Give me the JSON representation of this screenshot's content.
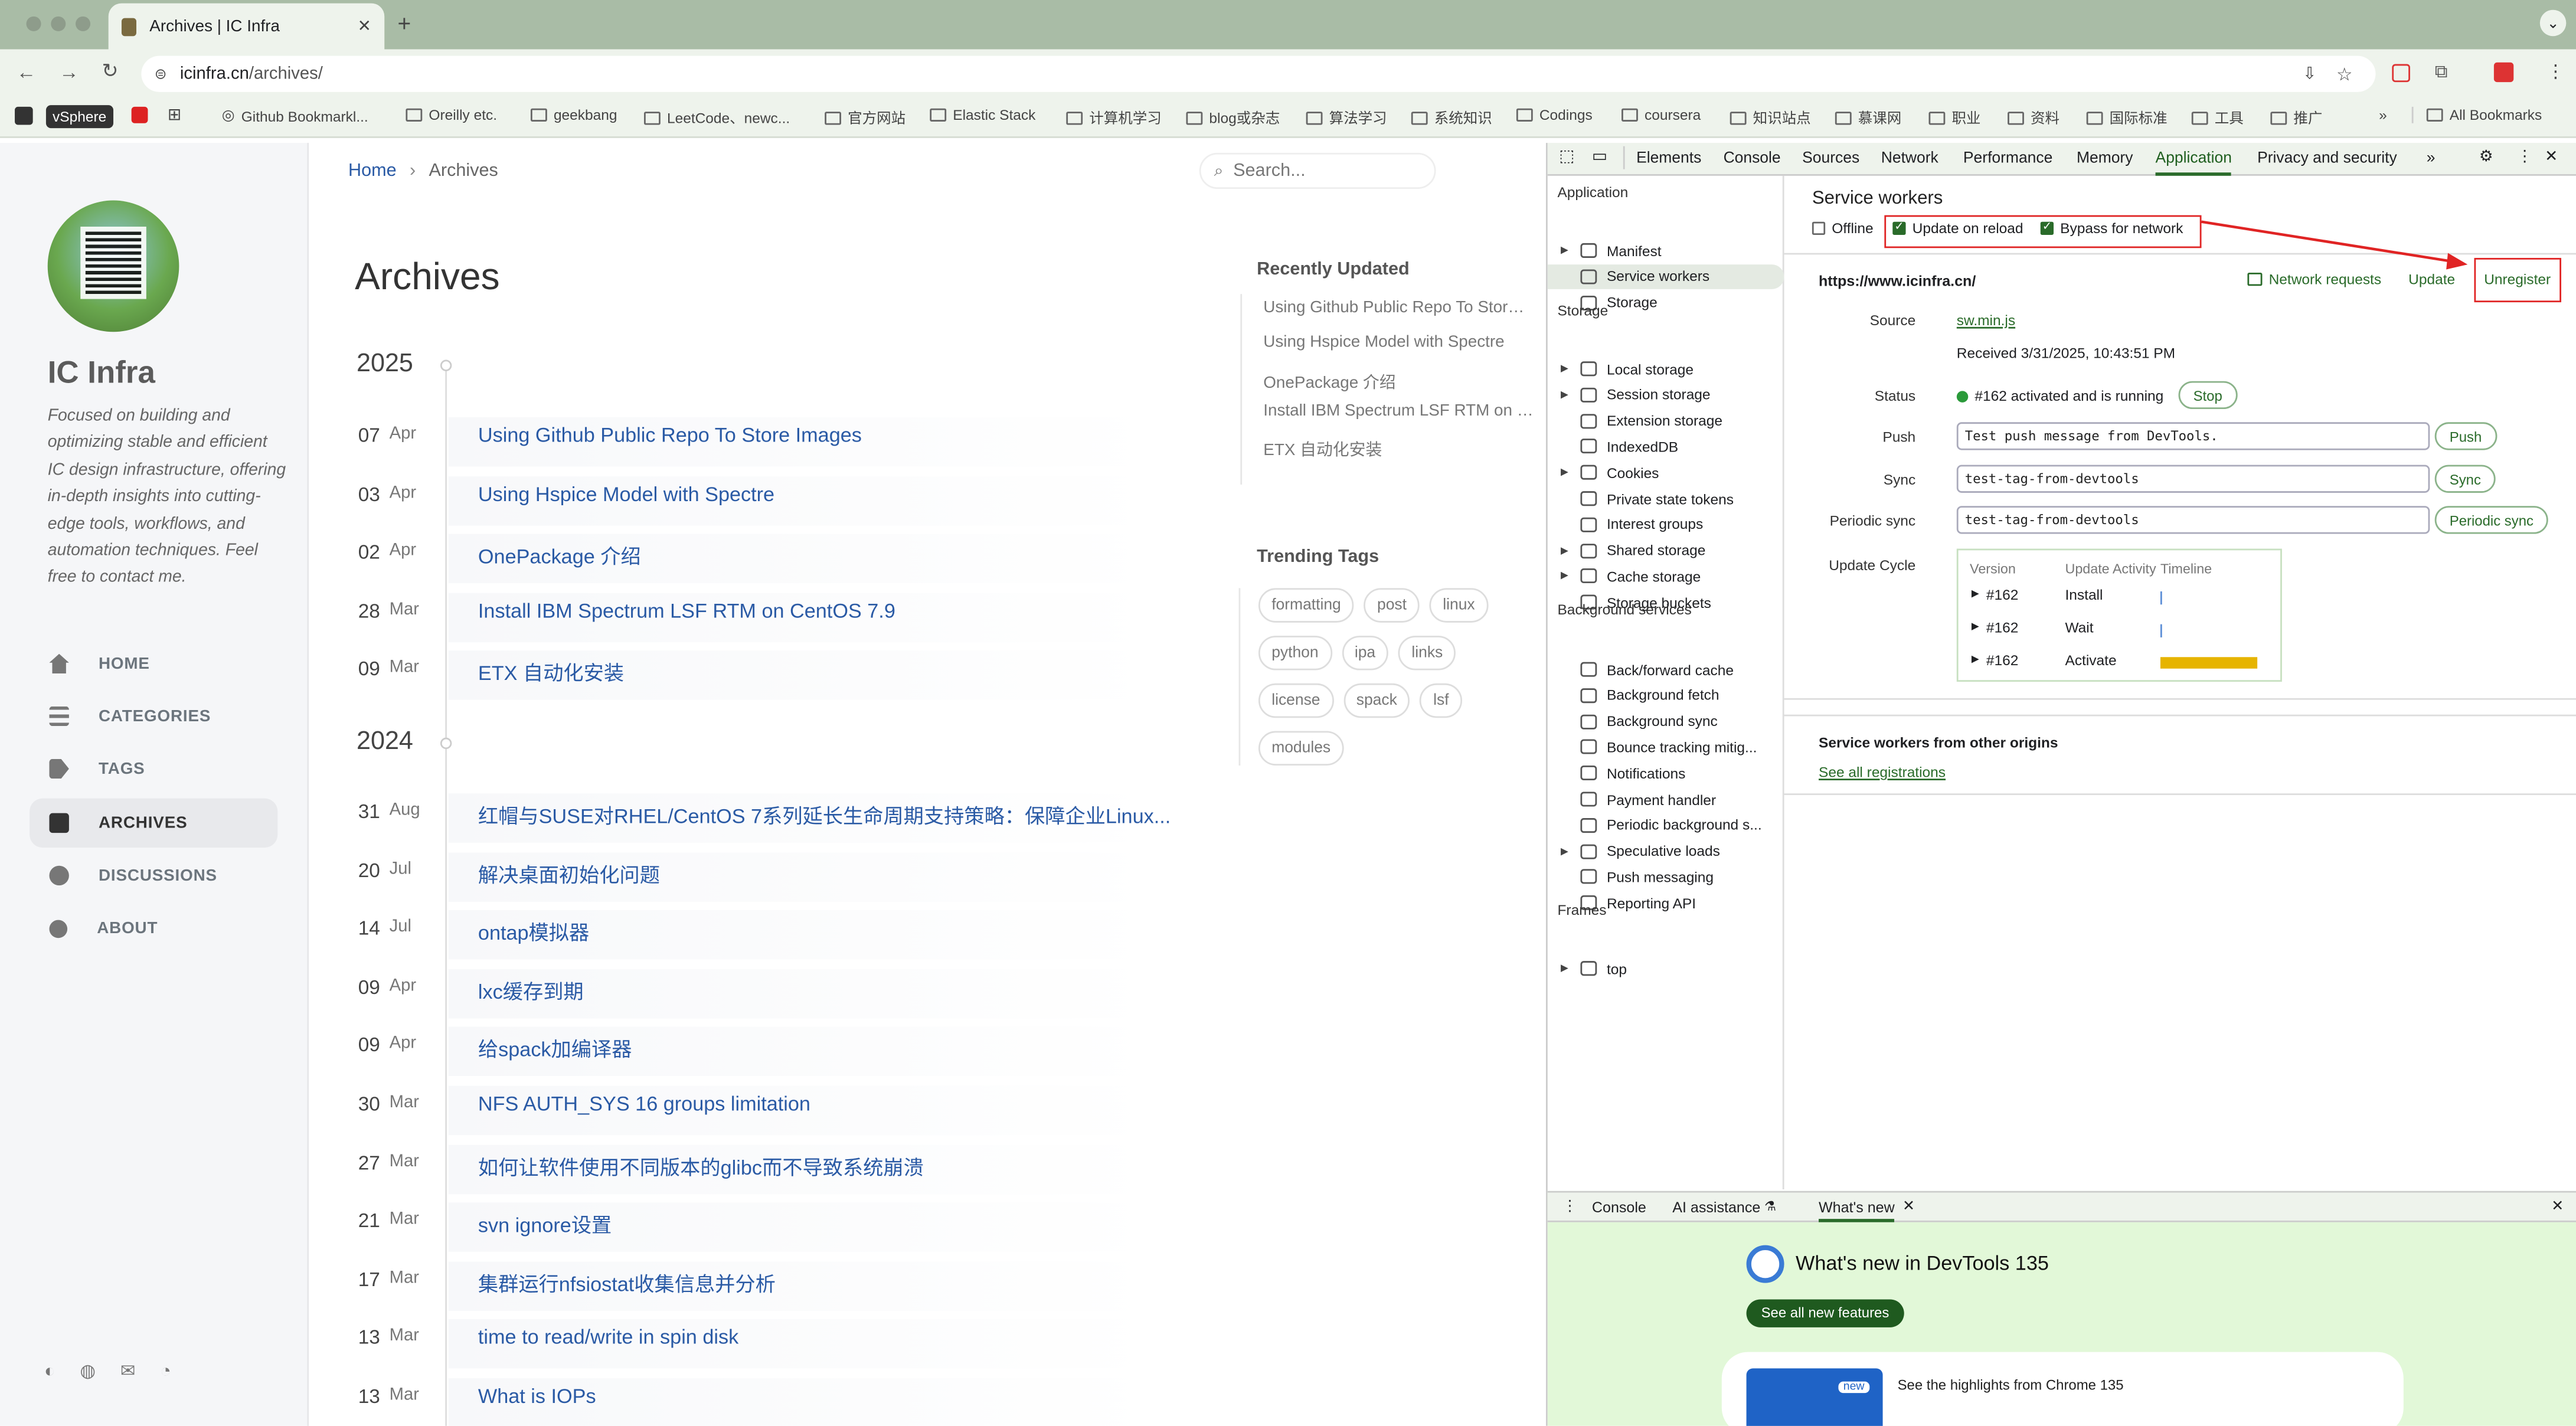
{
  "browser": {
    "tab_title": "Archives | IC Infra",
    "new_tab_symbol": "+",
    "url_host": "icinfra.cn",
    "url_path": "/archives/",
    "bookmarks": [
      "vSphere",
      "Github Bookmarkl...",
      "Oreilly etc.",
      "geekbang",
      "LeetCode、newc...",
      "官方网站",
      "Elastic Stack",
      "计算机学习",
      "blog或杂志",
      "算法学习",
      "系统知识",
      "Codings",
      "coursera",
      "知识站点",
      "慕课网",
      "职业",
      "资料",
      "国际标准",
      "工具",
      "推广"
    ],
    "all_bookmarks": "All Bookmarks"
  },
  "site": {
    "title": "IC Infra",
    "description": "Focused on building and optimizing stable and efficient IC design infrastructure, offering in-depth insights into cutting-edge tools, workflows, and automation techniques. Feel free to contact me.",
    "nav": [
      "HOME",
      "CATEGORIES",
      "TAGS",
      "ARCHIVES",
      "DISCUSSIONS",
      "ABOUT"
    ],
    "active_nav": "ARCHIVES"
  },
  "page": {
    "breadcrumb_home": "Home",
    "breadcrumb_sep": "›",
    "breadcrumb_current": "Archives",
    "search_placeholder": "Search...",
    "heading": "Archives",
    "year_2025": "2025",
    "year_2024": "2024",
    "posts_2025": [
      {
        "day": "07",
        "month": "Apr",
        "title": "Using Github Public Repo To Store Images"
      },
      {
        "day": "03",
        "month": "Apr",
        "title": "Using Hspice Model with Spectre"
      },
      {
        "day": "02",
        "month": "Apr",
        "title": "OnePackage 介绍"
      },
      {
        "day": "28",
        "month": "Mar",
        "title": "Install IBM Spectrum LSF RTM on CentOS 7.9"
      },
      {
        "day": "09",
        "month": "Mar",
        "title": "ETX 自动化安装"
      }
    ],
    "posts_2024": [
      {
        "day": "31",
        "month": "Aug",
        "title": "红帽与SUSE对RHEL/CentOS 7系列延长生命周期支持策略：保障企业Linux..."
      },
      {
        "day": "20",
        "month": "Jul",
        "title": "解决桌面初始化问题"
      },
      {
        "day": "14",
        "month": "Jul",
        "title": "ontap模拟器"
      },
      {
        "day": "09",
        "month": "Apr",
        "title": "lxc缓存到期"
      },
      {
        "day": "09",
        "month": "Apr",
        "title": "给spack加编译器"
      },
      {
        "day": "30",
        "month": "Mar",
        "title": "NFS AUTH_SYS 16 groups limitation"
      },
      {
        "day": "27",
        "month": "Mar",
        "title": "如何让软件使用不同版本的glibc而不导致系统崩溃"
      },
      {
        "day": "21",
        "month": "Mar",
        "title": "svn ignore设置"
      },
      {
        "day": "17",
        "month": "Mar",
        "title": "集群运行nfsiostat收集信息并分析"
      },
      {
        "day": "13",
        "month": "Mar",
        "title": "time to read/write in spin disk"
      },
      {
        "day": "13",
        "month": "Mar",
        "title": "What is IOPs"
      }
    ],
    "recently_updated_title": "Recently Updated",
    "recently_updated": [
      "Using Github Public Repo To Stor…",
      "Using Hspice Model with Spectre",
      "OnePackage 介绍",
      "Install IBM Spectrum LSF RTM on …",
      "ETX 自动化安装"
    ],
    "trending_title": "Trending Tags",
    "tags": [
      "formatting",
      "post",
      "linux",
      "python",
      "ipa",
      "links",
      "license",
      "spack",
      "lsf",
      "modules"
    ]
  },
  "devtools": {
    "tabs": [
      "Elements",
      "Console",
      "Sources",
      "Network",
      "Performance",
      "Memory",
      "Application",
      "Privacy and security"
    ],
    "active_tab": "Application",
    "more_tabs": "»",
    "sections": {
      "application": "Application",
      "storage": "Storage",
      "background": "Background services",
      "frames": "Frames"
    },
    "app_items": [
      "Manifest",
      "Service workers",
      "Storage"
    ],
    "storage_items": [
      "Local storage",
      "Session storage",
      "Extension storage",
      "IndexedDB",
      "Cookies",
      "Private state tokens",
      "Interest groups",
      "Shared storage",
      "Cache storage",
      "Storage buckets"
    ],
    "bg_items": [
      "Back/forward cache",
      "Background fetch",
      "Background sync",
      "Bounce tracking mitig...",
      "Notifications",
      "Payment handler",
      "Periodic background s...",
      "Speculative loads",
      "Push messaging",
      "Reporting API"
    ],
    "frame_items": [
      "top"
    ],
    "sw": {
      "title": "Service workers",
      "offline": "Offline",
      "update_on_reload": "Update on reload",
      "bypass": "Bypass for network",
      "origin": "https://www.icinfra.cn/",
      "network_requests": "Network requests",
      "update": "Update",
      "unregister": "Unregister",
      "source_label": "Source",
      "source_file": "sw.min.js",
      "received": "Received 3/31/2025, 10:43:51 PM",
      "status_label": "Status",
      "status_text": "#162 activated and is running",
      "stop": "Stop",
      "push_label": "Push",
      "push_value": "Test push message from DevTools.",
      "push_btn": "Push",
      "sync_label": "Sync",
      "sync_value": "test-tag-from-devtools",
      "sync_btn": "Sync",
      "psync_label": "Periodic sync",
      "psync_value": "test-tag-from-devtools",
      "psync_btn": "Periodic sync",
      "cycle_label": "Update Cycle",
      "cycle_headers": [
        "Version",
        "Update Activity",
        "Timeline"
      ],
      "cycle_rows": [
        {
          "version": "#162",
          "activity": "Install"
        },
        {
          "version": "#162",
          "activity": "Wait"
        },
        {
          "version": "#162",
          "activity": "Activate"
        }
      ],
      "other_title": "Service workers from other origins",
      "see_all": "See all registrations"
    },
    "drawer": {
      "tabs": [
        "Console",
        "AI assistance",
        "What's new"
      ],
      "active": "What's new",
      "headline": "What's new in DevTools 135",
      "see_all": "See all new features",
      "badge": "new",
      "highlight": "See the highlights from Chrome 135"
    }
  },
  "colors": {
    "accent": "#2a5aa5",
    "devtools_green": "#2a6b2a",
    "highlight_red": "#e02424",
    "drawer_bg": "#e2f8d8",
    "timeline_bar": "#e6b400"
  }
}
